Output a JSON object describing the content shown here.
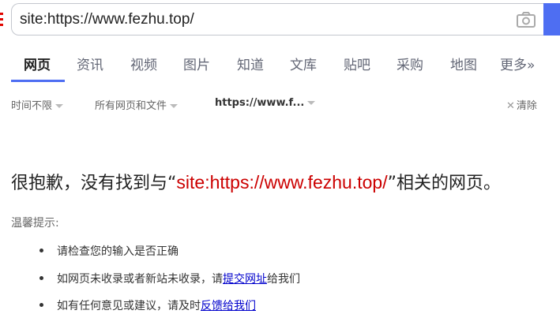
{
  "search": {
    "value": "site:https://www.fezhu.top/"
  },
  "tabs": [
    {
      "label": "网页",
      "active": true
    },
    {
      "label": "资讯"
    },
    {
      "label": "视频"
    },
    {
      "label": "图片"
    },
    {
      "label": "知道"
    },
    {
      "label": "文库"
    },
    {
      "label": "贴吧"
    },
    {
      "label": "采购"
    },
    {
      "label": "地图"
    },
    {
      "label": "更多»"
    }
  ],
  "filters": {
    "time": "时间不限",
    "type": "所有网页和文件",
    "site": "https://www.f...",
    "clear": "清除"
  },
  "message": {
    "prefix": "很抱歉，没有找到与“",
    "query": "site:https://www.fezhu.top/",
    "suffix": "”相关的网页。",
    "tip_title": "温馨提示:",
    "tips": [
      {
        "text": "请检查您的输入是否正确"
      },
      {
        "text": "如网页未收录或者新站未收录，请",
        "link": "提交网址",
        "after": "给我们"
      },
      {
        "text": "如有任何意见或建议，请及时",
        "link": "反馈给我们",
        "after": ""
      }
    ]
  },
  "colors": {
    "accent": "#4e6ef2",
    "query": "#cc0000",
    "link": "#0000cc"
  },
  "icons": {
    "camera": "camera-icon",
    "close": "close-icon"
  }
}
